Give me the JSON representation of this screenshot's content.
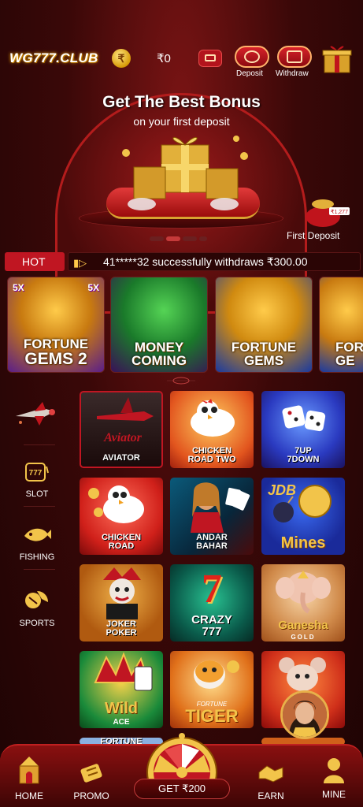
{
  "header": {
    "logo": "WG777.CLUB",
    "coin_symbol": "₹",
    "balance": "₹0",
    "deposit_label": "Deposit",
    "withdraw_label": "Withdraw"
  },
  "banner": {
    "title": "Get The Best Bonus",
    "subtitle": "on your first deposit",
    "first_deposit_label": "First Deposit",
    "bag_tag": "₹1,277",
    "active_slide": 1,
    "slide_count": 4
  },
  "notice": {
    "hot_label": "HOT",
    "message": "41*****32 successfully withdraws ₹300.00"
  },
  "hot_games": [
    {
      "title_line1": "FORTUNE",
      "title_line2": "GEMS 2",
      "badge": "5X"
    },
    {
      "title_line1": "MONEY",
      "title_line2": "COMING"
    },
    {
      "title_line1": "FORTUNE",
      "title_line2": "GEMS"
    },
    {
      "title_line1": "FOR",
      "title_line2": "GE"
    }
  ],
  "side_menu": [
    {
      "label": "",
      "icon": "rocket-icon"
    },
    {
      "label": "SLOT",
      "icon": "slot-machine-icon"
    },
    {
      "label": "FISHING",
      "icon": "fish-icon"
    },
    {
      "label": "SPORTS",
      "icon": "sports-ball-icon"
    }
  ],
  "games": [
    {
      "title": "AVIATOR",
      "logo": "Aviator"
    },
    {
      "title": "CHICKEN\nROAD TWO"
    },
    {
      "title": "7UP\n7DOWN"
    },
    {
      "title": "CHICKEN\nROAD"
    },
    {
      "title": "ANDAR\nBAHAR"
    },
    {
      "title": "Mines",
      "brand": "JDB"
    },
    {
      "title": "JOKER\nPOKER"
    },
    {
      "title": "CRAZY\n777",
      "big": "7"
    },
    {
      "title": "Ganesha",
      "sub": "GOLD"
    },
    {
      "title": "Wild",
      "sub": "ACE"
    },
    {
      "title": "TIGER",
      "sub": "FORTUNE"
    },
    {
      "title": "",
      "sub": ""
    },
    {
      "title": "FORTUNE"
    }
  ],
  "bottom_nav": {
    "home": "HOME",
    "promo": "PROMO",
    "get_bonus": "GET ₹200",
    "earn": "EARN",
    "mine": "MINE"
  },
  "colors": {
    "accent": "#c01622",
    "gold": "#f2b632",
    "background": "#3a0808"
  }
}
